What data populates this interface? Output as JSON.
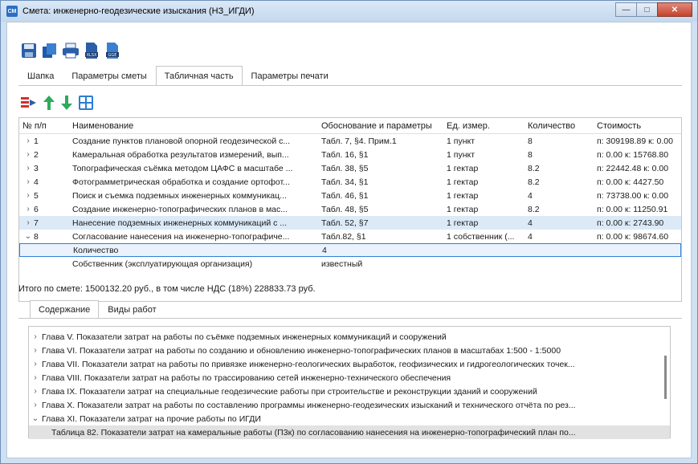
{
  "window": {
    "title": "Смета: инженерно-геодезические изыскания (НЗ_ИГДИ)",
    "app_icon": "СМ"
  },
  "toolbar": {
    "icons": [
      "save-icon",
      "copy-icon",
      "print-icon",
      "xlsx-icon",
      "gge-icon"
    ],
    "xlsx_label": "XLSX",
    "gge_label": "GGE"
  },
  "tabs": [
    {
      "label": "Шапка",
      "active": false
    },
    {
      "label": "Параметры сметы",
      "active": false
    },
    {
      "label": "Табличная часть",
      "active": true
    },
    {
      "label": "Параметры печати",
      "active": false
    }
  ],
  "grid": {
    "columns": [
      "№ п/п",
      "Наименование",
      "Обоснование и параметры",
      "Ед. измер.",
      "Количество",
      "Стоимость"
    ],
    "rows": [
      {
        "num": "1",
        "name": "Создание пунктов плановой опорной геодезической с...",
        "basis": "Табл. 7, §4. Прим.1",
        "unit": "1 пункт",
        "qty": "8",
        "cost": "п: 309198.89 к: 0.00"
      },
      {
        "num": "2",
        "name": "Камеральная обработка результатов измерений, вып...",
        "basis": "Табл. 16, §1",
        "unit": "1 пункт",
        "qty": "8",
        "cost": "п: 0.00 к: 15768.80"
      },
      {
        "num": "3",
        "name": "Топографическая съёмка методом ЦАФС в масштабе ...",
        "basis": "Табл. 38, §5",
        "unit": "1 гектар",
        "qty": "8.2",
        "cost": "п: 22442.48 к: 0.00"
      },
      {
        "num": "4",
        "name": "Фотограмметрическая обработка и создание ортофот...",
        "basis": "Табл. 34, §1",
        "unit": "1 гектар",
        "qty": "8.2",
        "cost": "п: 0.00 к: 4427.50"
      },
      {
        "num": "5",
        "name": "Поиск и съемка подземных инженерных коммуникац...",
        "basis": "Табл. 46, §1",
        "unit": "1 гектар",
        "qty": "4",
        "cost": "п: 73738.00 к: 0.00"
      },
      {
        "num": "6",
        "name": "Создание инженерно-топографических планов в мас...",
        "basis": "Табл. 48, §5",
        "unit": "1 гектар",
        "qty": "8.2",
        "cost": "п: 0.00 к: 11250.91"
      },
      {
        "num": "7",
        "name": "Нанесение подземных инженерных коммуникаций с ...",
        "basis": "Табл. 52, §7",
        "unit": "1 гектар",
        "qty": "4",
        "cost": "п: 0.00 к: 2743.90"
      },
      {
        "num": "8",
        "name": "Согласование нанесения на инженерно-топографиче...",
        "basis": "Табл.82, §1",
        "unit": "1 собственник (...",
        "qty": "4",
        "cost": "п: 0.00 к: 98674.60"
      }
    ],
    "sub_rows": [
      {
        "label": "Количество",
        "value": "4"
      },
      {
        "label": "Собственник (эксплуатирующая организация)",
        "value": "известный"
      }
    ]
  },
  "total_text": "Итого по смете: 1500132.20 руб., в том числе НДС (18%) 228833.73 руб.",
  "bottom_tabs": [
    {
      "label": "Содержание",
      "active": true
    },
    {
      "label": "Виды работ",
      "active": false
    }
  ],
  "tree": [
    {
      "text": "Глава V. Показатели затрат на работы по съёмке подземных инженерных коммуникаций и сооружений",
      "expanded": false
    },
    {
      "text": "Глава VI. Показатели затрат на работы по созданию и обновлению инженерно-топографических планов в масштабах 1:500 - 1:5000",
      "expanded": false
    },
    {
      "text": "Глава VII. Показатели затрат на работы по привязке инженерно-геологических выработок, геофизических и гидрогеологических точек...",
      "expanded": false
    },
    {
      "text": "Глава VIII. Показатели затрат на работы по трассированию сетей инженерно-технического обеспечения",
      "expanded": false
    },
    {
      "text": "Глава IX. Показатели затрат на специальные геодезические работы при строительстве и реконструкции зданий и сооружений",
      "expanded": false
    },
    {
      "text": "Глава X. Показатели затрат на работы по составлению программы инженерно-геодезических изысканий и технического отчёта по рез...",
      "expanded": false
    },
    {
      "text": "Глава XI. Показатели затрат на прочие работы по ИГДИ",
      "expanded": true
    },
    {
      "text": "Таблица 82. Показатели затрат на камеральные работы (П3к) по согласованию нанесения на инженерно-топографический план по...",
      "child": true
    }
  ],
  "colors": {
    "accent": "#2f7fd6",
    "arrow_up": "#2eaa5c",
    "arrow_down": "#2eaa5c",
    "titlebar": "#cfe0f3"
  }
}
